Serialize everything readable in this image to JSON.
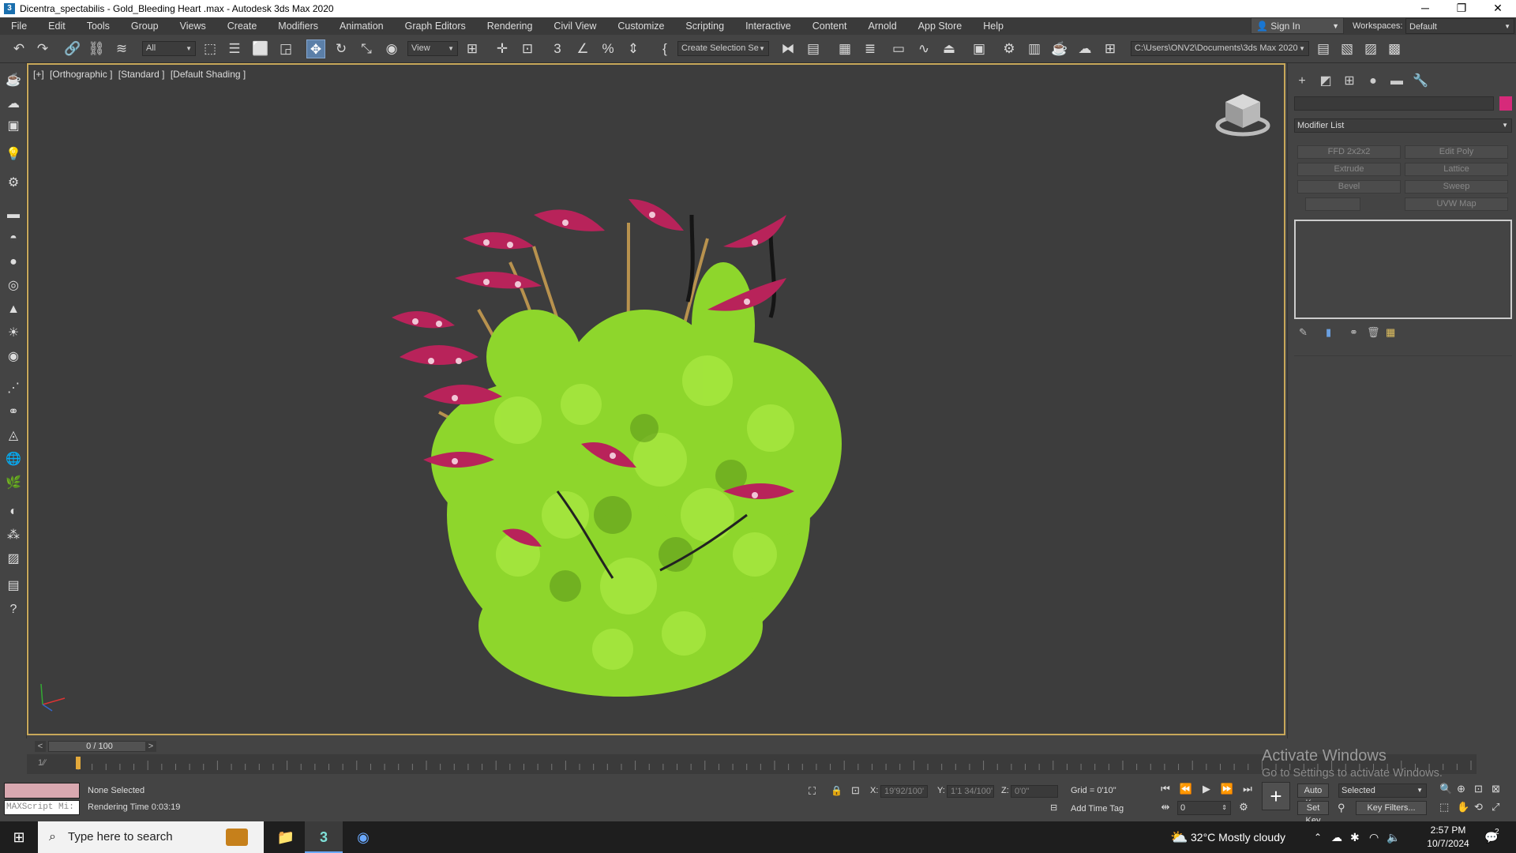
{
  "window": {
    "title": "Dicentra_spectabilis - Gold_Bleeding Heart .max - Autodesk 3ds Max 2020",
    "app_icon": "3",
    "controls": {
      "minimize": "─",
      "maximize": "❐",
      "close": "✕"
    }
  },
  "menu": [
    "File",
    "Edit",
    "Tools",
    "Group",
    "Views",
    "Create",
    "Modifiers",
    "Animation",
    "Graph Editors",
    "Rendering",
    "Civil View",
    "Customize",
    "Scripting",
    "Interactive",
    "Content",
    "Arnold",
    "App Store",
    "Help"
  ],
  "account": {
    "sign_in": "Sign In",
    "workspaces_label": "Workspaces:",
    "workspace": "Default"
  },
  "toolbar": {
    "selection_filter": "All",
    "ref_coord": "View",
    "named_selection": "Create Selection Se",
    "project_path": "C:\\Users\\ONV2\\Documents\\3ds Max 2020",
    "icons": [
      "undo-icon",
      "redo-icon",
      "link-icon",
      "unlink-icon",
      "bind-space-warp-icon",
      "select-object-icon",
      "select-by-name-icon",
      "rect-region-icon",
      "window-crossing-icon",
      "move-icon",
      "rotate-icon",
      "scale-icon",
      "placement-icon",
      "pivot-icon",
      "snap-toggle-icon",
      "angle-snap-icon",
      "percent-snap-icon",
      "spinner-snap-icon",
      "edit-named-sel-icon",
      "mirror-icon",
      "align-icon",
      "layer-explorer-icon",
      "scene-explorer-icon",
      "ribbon-icon",
      "curve-editor-icon",
      "schematic-icon",
      "material-editor-icon",
      "render-setup-icon",
      "rendered-frame-icon",
      "render-icon",
      "render-iterative-icon",
      "render-cloud-icon"
    ]
  },
  "viewport": {
    "labels": [
      "[+]",
      "[Orthographic ]",
      "[Standard ]",
      "[Default Shading ]"
    ],
    "active_border_color": "#c8a85a",
    "background_color": "#3d3d3d"
  },
  "command_panel": {
    "tabs": [
      "create-tab-icon",
      "modify-tab-icon",
      "hierarchy-tab-icon",
      "motion-tab-icon",
      "display-tab-icon",
      "utilities-tab-icon"
    ],
    "object_color": "#d62a7a",
    "modifier_list": "Modifier List",
    "modifier_buttons": [
      "FFD 2x2x2",
      "Edit Poly",
      "Extrude",
      "Lattice",
      "Bevel",
      "Sweep",
      "",
      "UVW Map"
    ]
  },
  "time_slider": {
    "value": "0 / 100",
    "prev": "<",
    "next": ">"
  },
  "timeline": {
    "ticks": 100
  },
  "status": {
    "maxscript_mini": "MAXScript Mi:",
    "selection": "None Selected",
    "rendering_time": "Rendering Time  0:03:19",
    "x_label": "X:",
    "x_value": "19'92/100'",
    "y_label": "Y:",
    "y_value": "1'1 34/100'",
    "z_label": "Z:",
    "z_value": "0'0\"",
    "grid": "Grid = 0'10\"",
    "add_time_tag": "Add Time Tag",
    "auto_key": "Auto Key",
    "set_key": "Set Key",
    "selected": "Selected",
    "frame": "0",
    "key_filters": "Key Filters..."
  },
  "watermark": {
    "title": "Activate Windows",
    "subtitle": "Go to Settings to activate Windows."
  },
  "taskbar": {
    "search_placeholder": "Type here to search",
    "weather": "32°C  Mostly cloudy",
    "time": "2:57 PM",
    "date": "10/7/2024",
    "notifications": "2"
  }
}
